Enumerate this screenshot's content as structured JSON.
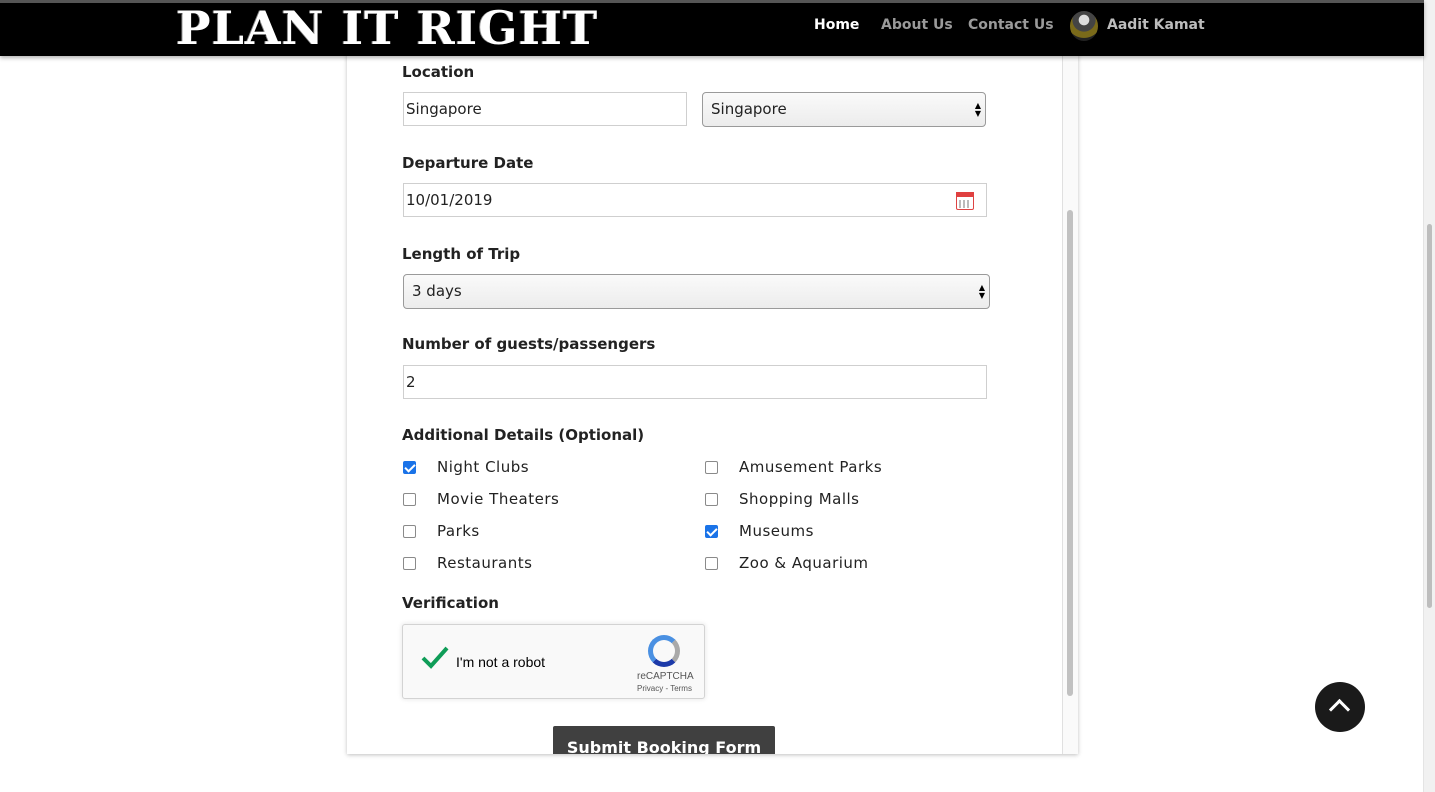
{
  "header": {
    "logo": "PLAN IT RIGHT",
    "nav": [
      "Home",
      "About Us",
      "Contact Us"
    ],
    "user_name": "Aadit Kamat"
  },
  "form": {
    "location_label": "Location",
    "location_value": "Singapore",
    "location_select": "Singapore",
    "departure_label": "Departure Date",
    "departure_value": "10/01/2019",
    "length_label": "Length of Trip",
    "length_value": "3 days",
    "guests_label": "Number of guests/passengers",
    "guests_value": "2",
    "details_label": "Additional Details (Optional)",
    "details": [
      {
        "label": "Night Clubs",
        "checked": true
      },
      {
        "label": "Amusement Parks",
        "checked": false
      },
      {
        "label": "Movie Theaters",
        "checked": false
      },
      {
        "label": "Shopping Malls",
        "checked": false
      },
      {
        "label": "Parks",
        "checked": false
      },
      {
        "label": "Museums",
        "checked": true
      },
      {
        "label": "Restaurants",
        "checked": false
      },
      {
        "label": "Zoo & Aquarium",
        "checked": false
      }
    ],
    "verification_label": "Verification",
    "recaptcha": {
      "text": "I'm not a robot",
      "brand": "reCAPTCHA",
      "links": "Privacy - Terms",
      "verified": true
    },
    "submit_label": "Submit Booking Form"
  },
  "colors": {
    "checkbox_accent": "#1a73e8",
    "header_bg": "#000000",
    "button_bg": "#404040"
  }
}
